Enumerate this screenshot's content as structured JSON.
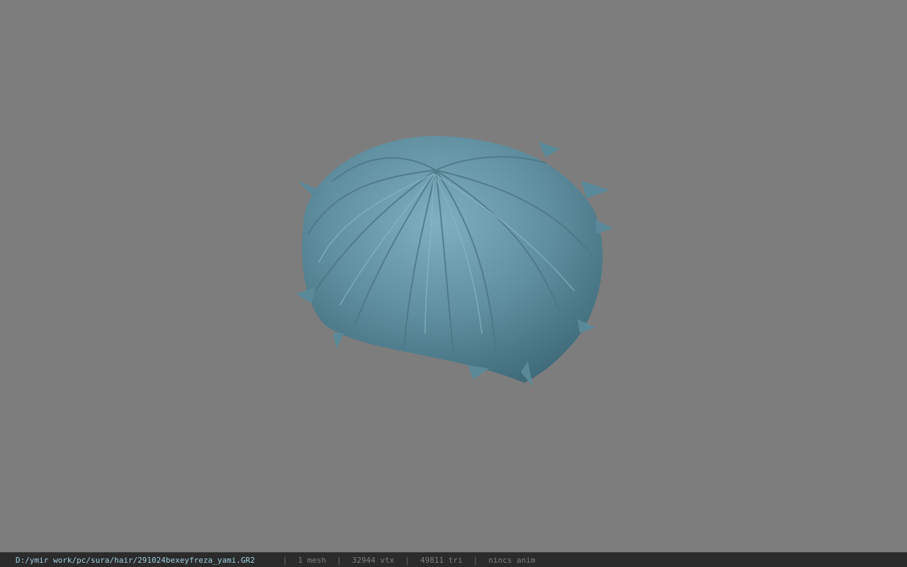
{
  "viewport": {
    "background": "#7d7d7d",
    "model_color": "#5f8e9e",
    "model_name": "hair-mesh"
  },
  "status": {
    "file_path": "D:/ymir work/pc/sura/hair/291024bexeyfreza_yami.GR2",
    "separator": "|",
    "mesh_count": "1 mesh",
    "vertex_count": "32944 vtx",
    "triangle_count": "49811 tri",
    "anim_status": "nincs anim"
  }
}
